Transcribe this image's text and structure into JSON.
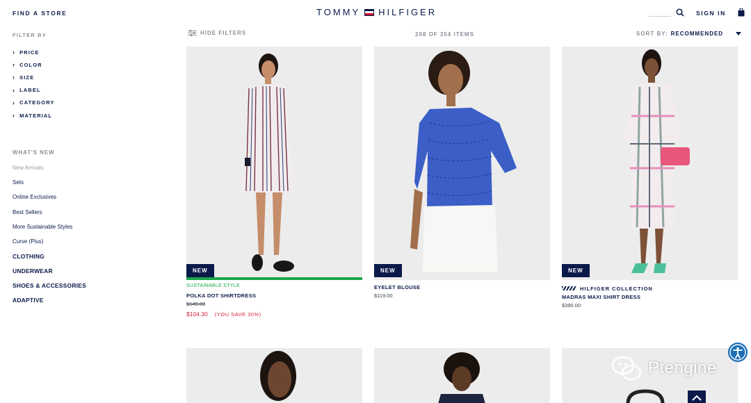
{
  "header": {
    "find_store": "FIND A STORE",
    "logo_left": "TOMMY",
    "logo_right": "HILFIGER",
    "sign_in": "SIGN IN",
    "icons": [
      "search-icon",
      "shopping-bag-icon"
    ]
  },
  "filters": {
    "heading": "FILTER BY",
    "items": [
      "PRICE",
      "COLOR",
      "SIZE",
      "LABEL",
      "CATEGORY",
      "MATERIAL"
    ]
  },
  "categories": {
    "heading": "WHAT'S NEW",
    "sub_items": [
      "New Arrivals",
      "Sets",
      "Online Exclusives",
      "Best Sellers",
      "More Sustainable Styles",
      "Curve (Plus)"
    ],
    "main_items": [
      "CLOTHING",
      "UNDERWEAR",
      "SHOES & ACCESSORIES",
      "ADAPTIVE"
    ]
  },
  "toolbar": {
    "hide_filters": "HIDE FILTERS",
    "item_count": "208 OF 354 ITEMS",
    "sort_label": "SORT BY:",
    "sort_value": "RECOMMENDED"
  },
  "products": [
    {
      "badge": "NEW",
      "kicker": "SUSTAINABLE STYLE",
      "name": "POLKA DOT SHIRTDRESS",
      "original_price": "$149.00",
      "sale_price": "$104.30",
      "savings": "(YOU SAVE 30%)"
    },
    {
      "badge": "NEW",
      "name": "EYELET BLOUSE",
      "price": "$119.00"
    },
    {
      "badge": "NEW",
      "kicker": "HILFIGER COLLECTION",
      "name": "MADRAS MAXI SHIRT DRESS",
      "price": "$390.00"
    }
  ],
  "watermark": "Ptengine",
  "colors": {
    "navy": "#0b1a4a",
    "sale_red": "#d0243a",
    "sustainable_green": "#1aa64a",
    "accessibility_blue": "#1d70b8"
  }
}
